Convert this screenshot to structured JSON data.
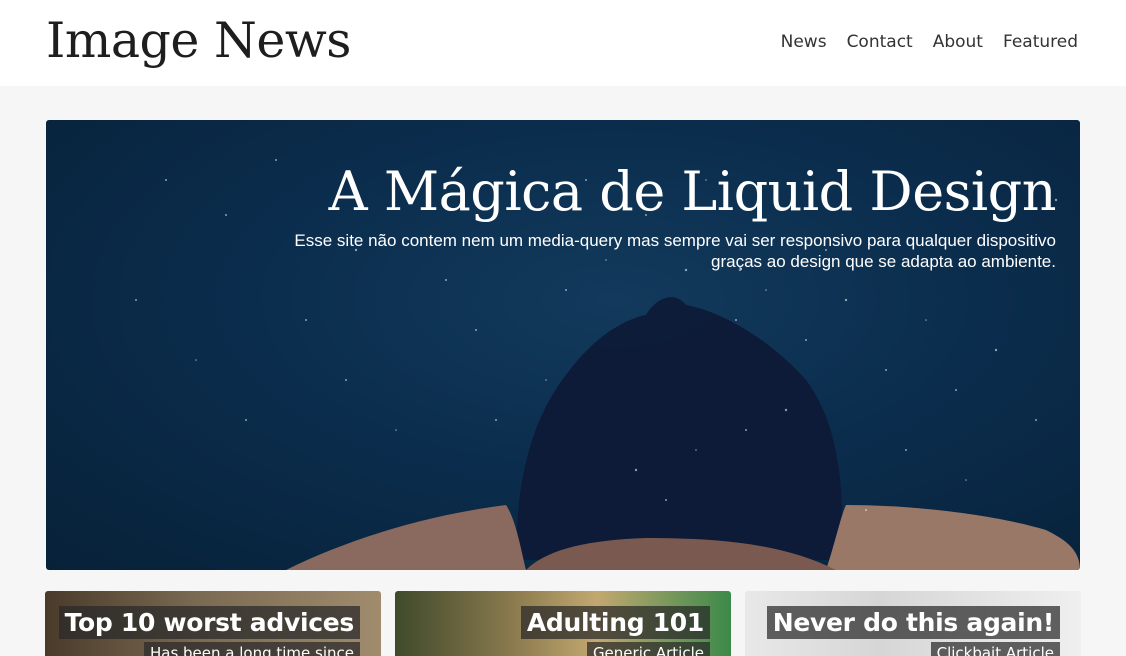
{
  "header": {
    "logo": "Image News",
    "nav": [
      "News",
      "Contact",
      "About",
      "Featured"
    ]
  },
  "hero": {
    "title": "A Mágica de Liquid Design",
    "subtitle": "Esse site não contem nem um media-query mas sempre vai ser responsivo para qualquer dispositivo graças ao design que se adapta ao ambiente."
  },
  "cards": [
    {
      "title": "Top 10 worst advices",
      "subtitle": "Has been a long time since"
    },
    {
      "title": "Adulting 101",
      "subtitle": "Generic Article"
    },
    {
      "title": "Never do this again!",
      "subtitle": "Clickbait Article"
    }
  ],
  "colors": {
    "header_bg": "#ffffff",
    "page_bg": "#f6f6f6",
    "hero_bg": "#0b2d4d",
    "text_dark": "#1e1e1e"
  }
}
